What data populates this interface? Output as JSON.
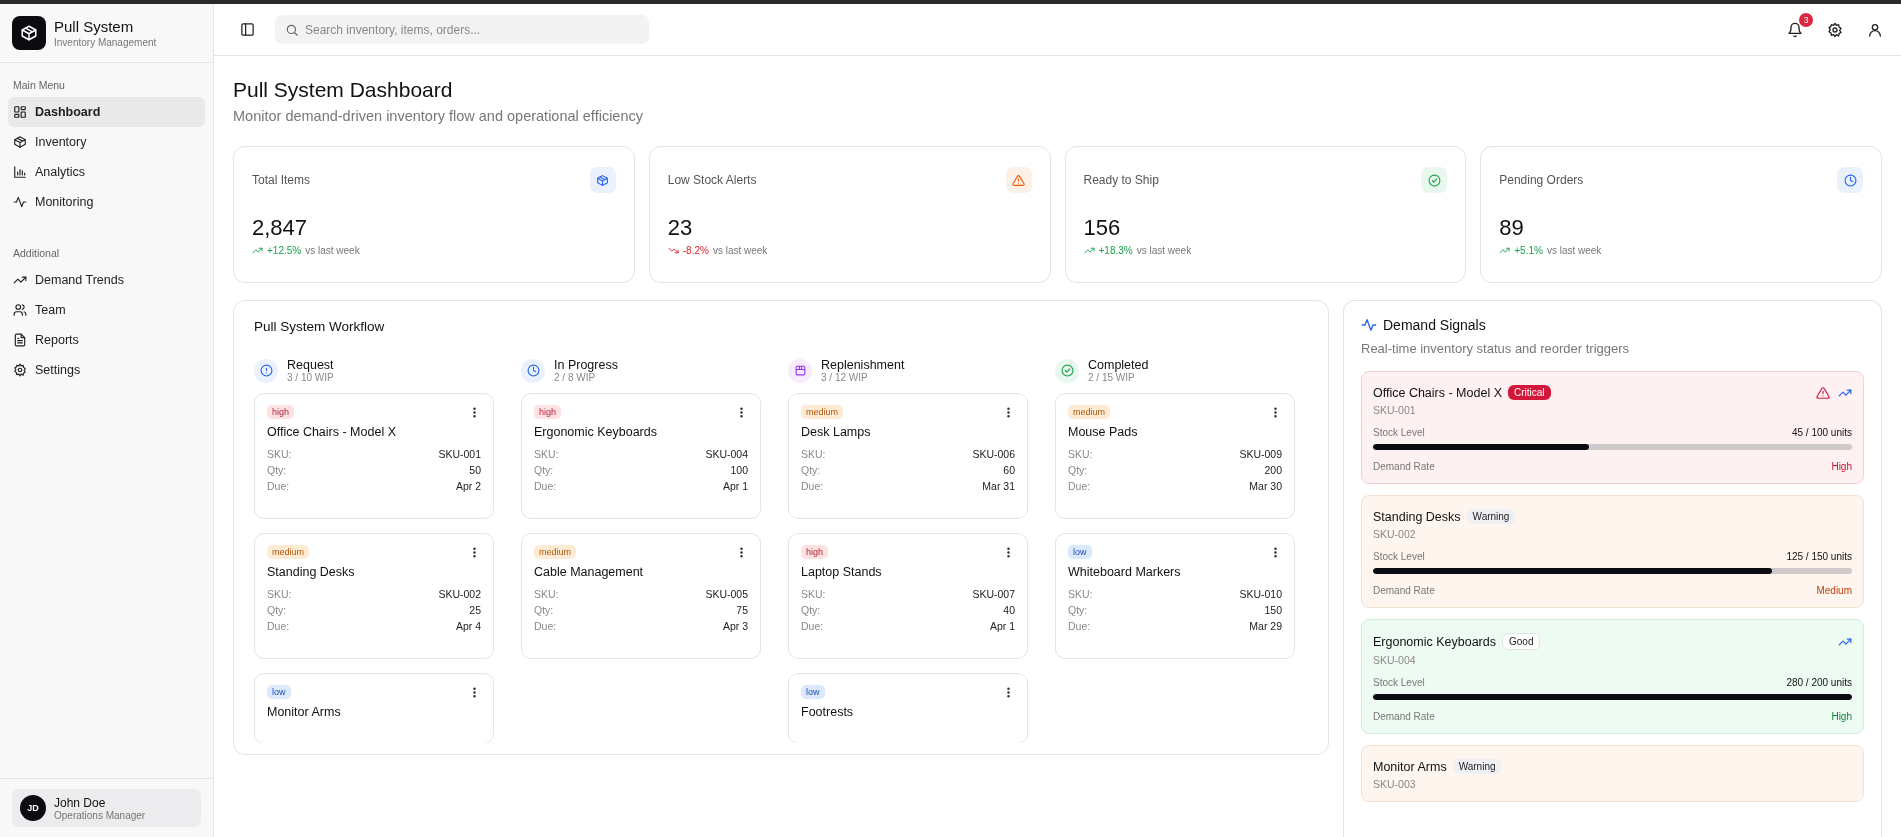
{
  "sidebar": {
    "brand": {
      "title": "Pull System",
      "subtitle": "Inventory Management"
    },
    "sections": [
      {
        "heading": "Main Menu",
        "items": [
          {
            "label": "Dashboard",
            "selected": true
          },
          {
            "label": "Inventory",
            "selected": false
          },
          {
            "label": "Analytics",
            "selected": false
          },
          {
            "label": "Monitoring",
            "selected": false
          }
        ]
      },
      {
        "heading": "Additional",
        "items": [
          {
            "label": "Demand Trends",
            "selected": false
          },
          {
            "label": "Team",
            "selected": false
          },
          {
            "label": "Reports",
            "selected": false
          },
          {
            "label": "Settings",
            "selected": false
          }
        ]
      }
    ],
    "user": {
      "initials": "JD",
      "name": "John Doe",
      "role": "Operations Manager"
    }
  },
  "topbar": {
    "search": {
      "placeholder": "Search inventory, items, orders..."
    },
    "notifications": "3"
  },
  "page": {
    "title": "Pull System Dashboard",
    "subtitle": "Monitor demand-driven inventory flow and operational efficiency"
  },
  "stats": [
    {
      "label": "Total Items",
      "value": "2,847",
      "change": "+12.5%",
      "kind": "up",
      "note": "vs last week"
    },
    {
      "label": "Low Stock Alerts",
      "value": "23",
      "change": "-8.2%",
      "kind": "down",
      "note": "vs last week"
    },
    {
      "label": "Ready to Ship",
      "value": "156",
      "change": "+18.3%",
      "kind": "up",
      "note": "vs last week"
    },
    {
      "label": "Pending Orders",
      "value": "89",
      "change": "+5.1%",
      "kind": "up",
      "note": "vs last week"
    }
  ],
  "workflow": {
    "title": "Pull System Workflow",
    "columns": [
      {
        "name": "Request",
        "wip": "3 / 10 WIP",
        "cards": [
          {
            "priority": "high",
            "name": "Office Chairs - Model X",
            "rows": [
              {
                "label": "SKU:",
                "value": "SKU-001"
              },
              {
                "label": "Qty:",
                "value": "50"
              },
              {
                "label": "Due:",
                "value": "Apr 2"
              }
            ]
          },
          {
            "priority": "medium",
            "name": "Standing Desks",
            "rows": [
              {
                "label": "SKU:",
                "value": "SKU-002"
              },
              {
                "label": "Qty:",
                "value": "25"
              },
              {
                "label": "Due:",
                "value": "Apr 4"
              }
            ]
          },
          {
            "priority": "low",
            "name": "Monitor Arms"
          }
        ]
      },
      {
        "name": "In Progress",
        "wip": "2 / 8 WIP",
        "cards": [
          {
            "priority": "high",
            "name": "Ergonomic Keyboards",
            "rows": [
              {
                "label": "SKU:",
                "value": "SKU-004"
              },
              {
                "label": "Qty:",
                "value": "100"
              },
              {
                "label": "Due:",
                "value": "Apr 1"
              }
            ]
          },
          {
            "priority": "medium",
            "name": "Cable Management",
            "rows": [
              {
                "label": "SKU:",
                "value": "SKU-005"
              },
              {
                "label": "Qty:",
                "value": "75"
              },
              {
                "label": "Due:",
                "value": "Apr 3"
              }
            ]
          }
        ]
      },
      {
        "name": "Replenishment",
        "wip": "3 / 12 WIP",
        "cards": [
          {
            "priority": "medium",
            "name": "Desk Lamps",
            "rows": [
              {
                "label": "SKU:",
                "value": "SKU-006"
              },
              {
                "label": "Qty:",
                "value": "60"
              },
              {
                "label": "Due:",
                "value": "Mar 31"
              }
            ]
          },
          {
            "priority": "high",
            "name": "Laptop Stands",
            "rows": [
              {
                "label": "SKU:",
                "value": "SKU-007"
              },
              {
                "label": "Qty:",
                "value": "40"
              },
              {
                "label": "Due:",
                "value": "Apr 1"
              }
            ]
          },
          {
            "priority": "low",
            "name": "Footrests"
          }
        ]
      },
      {
        "name": "Completed",
        "wip": "2 / 15 WIP",
        "cards": [
          {
            "priority": "medium",
            "name": "Mouse Pads",
            "rows": [
              {
                "label": "SKU:",
                "value": "SKU-009"
              },
              {
                "label": "Qty:",
                "value": "200"
              },
              {
                "label": "Due:",
                "value": "Mar 30"
              }
            ]
          },
          {
            "priority": "low",
            "name": "Whiteboard Markers",
            "rows": [
              {
                "label": "SKU:",
                "value": "SKU-010"
              },
              {
                "label": "Qty:",
                "value": "150"
              },
              {
                "label": "Due:",
                "value": "Mar 29"
              }
            ]
          }
        ]
      }
    ]
  },
  "signals": {
    "title": "Demand Signals",
    "subtitle": "Real-time inventory status and reorder triggers",
    "items": [
      {
        "name": "Office Chairs - Model X",
        "kind": "critical",
        "badge": "Critical",
        "alert": true,
        "trending": true,
        "sku": "SKU-001",
        "stock_label": "Stock Level",
        "stock": "45 / 100 units",
        "level": 0.45,
        "rate_label": "Demand Rate",
        "rate": "High"
      },
      {
        "name": "Standing Desks",
        "kind": "warning",
        "badge": "Warning",
        "alert": false,
        "trending": false,
        "sku": "SKU-002",
        "stock_label": "Stock Level",
        "stock": "125 / 150 units",
        "level": 0.833,
        "rate_label": "Demand Rate",
        "rate": "Medium"
      },
      {
        "name": "Ergonomic Keyboards",
        "kind": "good",
        "badge": "Good",
        "alert": false,
        "trending": true,
        "sku": "SKU-004",
        "stock_label": "Stock Level",
        "stock": "280 / 200 units",
        "level": 1,
        "rate_label": "Demand Rate",
        "rate": "High"
      },
      {
        "name": "Monitor Arms",
        "kind": "warning",
        "badge": "Warning",
        "alert": false,
        "trending": false,
        "sku": "SKU-003"
      }
    ]
  }
}
